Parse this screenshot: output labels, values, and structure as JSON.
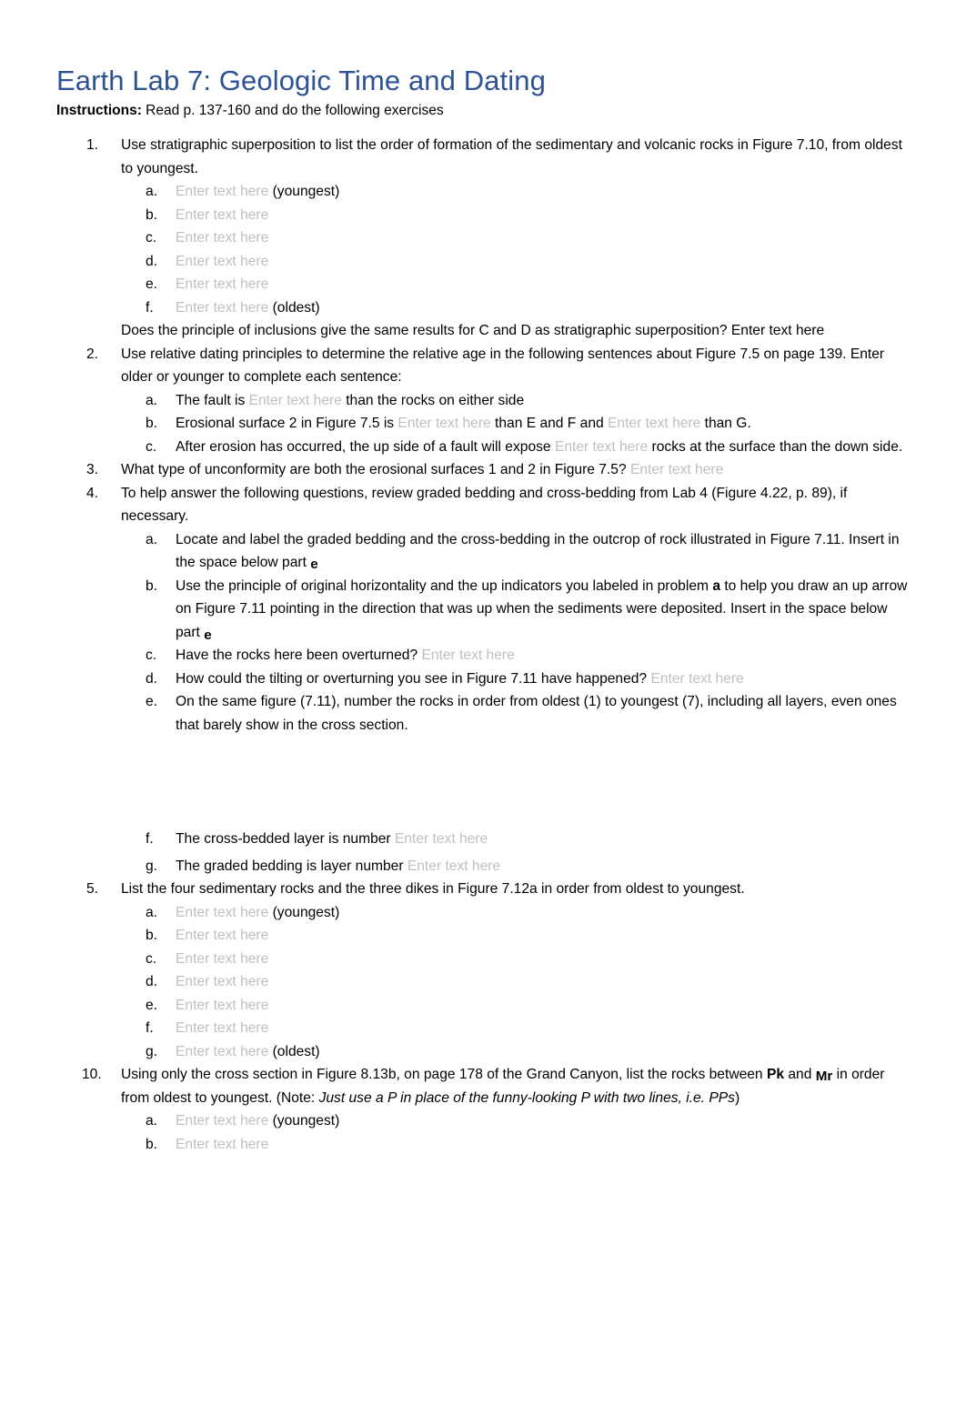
{
  "document": {
    "title": "Earth Lab 7: Geologic Time and Dating",
    "instructions_label": "Instructions:",
    "instructions_text": " Read p. 137-160 and do the following exercises",
    "title_color": "#2E5395",
    "placeholder_color": "#BFBFBF",
    "placeholder_text": "Enter text here"
  },
  "items": {
    "q1": {
      "marker": "1.",
      "text": "Use stratigraphic superposition to list the order of formation of the sedimentary and volcanic rocks in Figure 7.10, from oldest to youngest.",
      "sub": [
        {
          "marker": "a.",
          "placeholder": "Enter text here",
          "suffix": " (youngest)"
        },
        {
          "marker": "b.",
          "placeholder": "Enter text here",
          "suffix": ""
        },
        {
          "marker": "c.",
          "placeholder": "Enter text here",
          "suffix": ""
        },
        {
          "marker": "d.",
          "placeholder": "Enter text here",
          "suffix": ""
        },
        {
          "marker": "e.",
          "placeholder": "Enter text here",
          "suffix": ""
        },
        {
          "marker": "f.",
          "placeholder": "Enter text here",
          "suffix": " (oldest)"
        }
      ],
      "trailing_text": "Does the principle of inclusions give the same results for C and D as stratigraphic superposition? ",
      "trailing_placeholder": "Enter text here"
    },
    "q2": {
      "marker": "2.",
      "text": "Use relative dating principles to determine the relative age in the following sentences about Figure 7.5 on page 139. Enter older or younger to complete each sentence:",
      "sub": {
        "a": {
          "marker": "a.",
          "part1": "The fault is ",
          "ph1": "Enter text here",
          "part2": " than the rocks on either side"
        },
        "b": {
          "marker": "b.",
          "part1": "Erosional surface 2 in Figure 7.5 is ",
          "ph1": "Enter text here",
          "part2": " than E and F and ",
          "ph2": "Enter text here",
          "part3": " than G."
        },
        "c": {
          "marker": "c.",
          "part1": "After erosion has occurred, the up side of a fault will expose ",
          "ph1": "Enter text here",
          "part2": " rocks at the surface than the down side."
        }
      }
    },
    "q3": {
      "marker": "3.",
      "text": "What type of unconformity are both the erosional surfaces 1 and 2 in Figure 7.5? ",
      "placeholder": "Enter text here"
    },
    "q4": {
      "marker": "4.",
      "text": "To help answer the following questions, review graded bedding and cross-bedding from Lab 4 (Figure 4.22, p. 89), if necessary.",
      "sub": {
        "a": {
          "marker": "a.",
          "part1": "Locate and label the graded bedding and the cross-bedding in the outcrop of rock illustrated in Figure 7.11. Insert in the space below part ",
          "bold_ref": "e"
        },
        "b": {
          "marker": "b.",
          "part1": "Use the principle of original horizontality and the up indicators you labeled in problem ",
          "bold_ref1": "a",
          "part2": " to help you draw an up arrow on Figure 7.11 pointing in the direction that was up when the sediments were deposited. Insert in the space below part ",
          "bold_ref2": "e"
        },
        "c": {
          "marker": "c.",
          "part1": "Have the rocks here been overturned? ",
          "ph1": "Enter text here"
        },
        "d": {
          "marker": "d.",
          "part1": "How could the tilting or overturning you see in Figure 7.11 have happened? ",
          "ph1": "Enter text here"
        },
        "e": {
          "marker": "e.",
          "part1": "On the same figure (7.11), number the rocks in order from oldest (1) to youngest (7), including all layers, even ones that barely show in the cross section."
        },
        "f": {
          "marker": "f.",
          "part1": "The cross-bedded layer is number ",
          "ph1": "Enter text here"
        },
        "g": {
          "marker": "g.",
          "part1": "The graded bedding is layer number ",
          "ph1": "Enter text here"
        }
      }
    },
    "q5": {
      "marker": "5.",
      "text": "List the four sedimentary rocks and the three dikes in Figure 7.12a in order from oldest to youngest.",
      "sub": [
        {
          "marker": "a.",
          "placeholder": "Enter text here",
          "suffix": " (youngest)"
        },
        {
          "marker": "b.",
          "placeholder": "Enter text here",
          "suffix": ""
        },
        {
          "marker": "c.",
          "placeholder": "Enter text here",
          "suffix": ""
        },
        {
          "marker": "d.",
          "placeholder": "Enter text here",
          "suffix": ""
        },
        {
          "marker": "e.",
          "placeholder": "Enter text here",
          "suffix": ""
        },
        {
          "marker": "f.",
          "placeholder": "Enter text here",
          "suffix": ""
        },
        {
          "marker": "g.",
          "placeholder": "Enter text here",
          "suffix": " (oldest)"
        }
      ]
    },
    "q10": {
      "marker": "10.",
      "part1": "Using only the cross section in Figure 8.13b, on page 178 of the Grand Canyon, list the rocks between ",
      "unit1": "Pk",
      "part2": " and ",
      "unit2": "Mr",
      "part3": " in order from oldest to youngest. (",
      "note_label": "Note:",
      "note_italic": " Just use a P in place of the funny-looking P with two lines, i.e. PPs",
      "part4": ")",
      "sub": [
        {
          "marker": "a.",
          "placeholder": "Enter text here",
          "suffix": " (youngest)"
        },
        {
          "marker": "b.",
          "placeholder": "Enter text here",
          "suffix": ""
        }
      ]
    }
  }
}
